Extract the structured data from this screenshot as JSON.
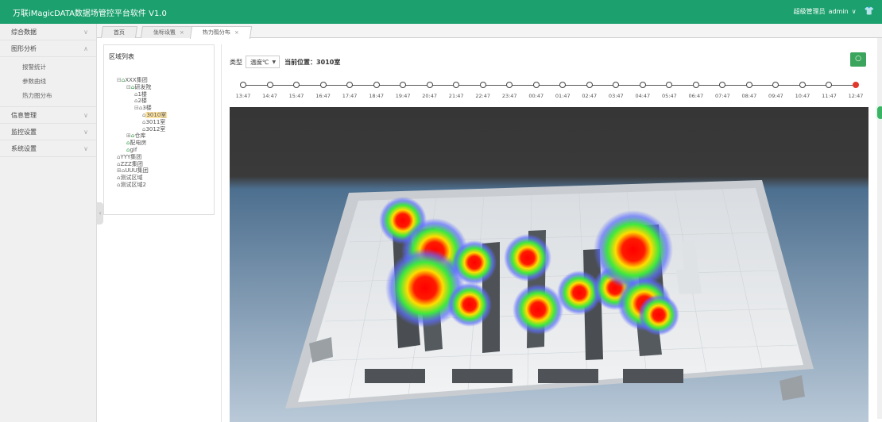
{
  "app": {
    "title": "万联iMagicDATA数据场管控平台软件 V1.0",
    "role": "超级管理员",
    "username": "admin",
    "caret": "∨",
    "shirt_icon": "shirt-icon"
  },
  "tabs": [
    {
      "label": "首页",
      "closable": false
    },
    {
      "label": "坐标设置",
      "closable": true
    },
    {
      "label": "热力图分布",
      "closable": true,
      "active": true
    }
  ],
  "sidebar": {
    "items": [
      {
        "label": "综合数据",
        "chevron": "∨"
      },
      {
        "label": "图形分析",
        "chevron": "∧",
        "expanded": true,
        "children": [
          "报警统计",
          "参数曲线",
          "热力图分布"
        ]
      },
      {
        "label": "信息管理",
        "chevron": "∨"
      },
      {
        "label": "监控设置",
        "chevron": "∨"
      },
      {
        "label": "系统设置",
        "chevron": "∨"
      }
    ]
  },
  "region": {
    "title": "区域列表",
    "tree": [
      {
        "label": "XXX集团",
        "level": 1,
        "toggle": "⊟"
      },
      {
        "label": "研发院",
        "level": 2,
        "toggle": "⊟"
      },
      {
        "label": "1楼",
        "level": 3
      },
      {
        "label": "2楼",
        "level": 3
      },
      {
        "label": "3楼",
        "level": 3,
        "toggle": "⊟"
      },
      {
        "label": "3010室",
        "level": 4,
        "selected": true
      },
      {
        "label": "3011室",
        "level": 4
      },
      {
        "label": "3012室",
        "level": 4
      },
      {
        "label": "仓库",
        "level": 2,
        "toggle": "⊞"
      },
      {
        "label": "配电房",
        "level": 2
      },
      {
        "label": "gif",
        "level": 2
      },
      {
        "label": "YYY集团",
        "level": 1
      },
      {
        "label": "ZZZ集团",
        "level": 1
      },
      {
        "label": "UUU集团",
        "level": 1,
        "toggle": "⊞"
      },
      {
        "label": "测试区域",
        "level": 1
      },
      {
        "label": "测试区域2",
        "level": 1
      }
    ]
  },
  "filter": {
    "type_label": "类型",
    "type_value": "温度℃",
    "position_label": "当前位置：3010室"
  },
  "timeline": {
    "times": [
      "13:47",
      "14:47",
      "15:47",
      "16:47",
      "17:47",
      "18:47",
      "19:47",
      "20:47",
      "21:47",
      "22:47",
      "23:47",
      "00:47",
      "01:47",
      "02:47",
      "03:47",
      "04:47",
      "05:47",
      "06:47",
      "07:47",
      "08:47",
      "09:47",
      "10:47",
      "11:47",
      "12:47"
    ],
    "active_index": 23
  },
  "heatmap": {
    "room_color": "#e4e6e8",
    "rack_color": "#4a4e52",
    "hotspot_color": "#ff0000"
  },
  "icons": {
    "refresh": "refresh-icon",
    "building": "building-icon",
    "collapse": "collapse-arrow-icon"
  }
}
